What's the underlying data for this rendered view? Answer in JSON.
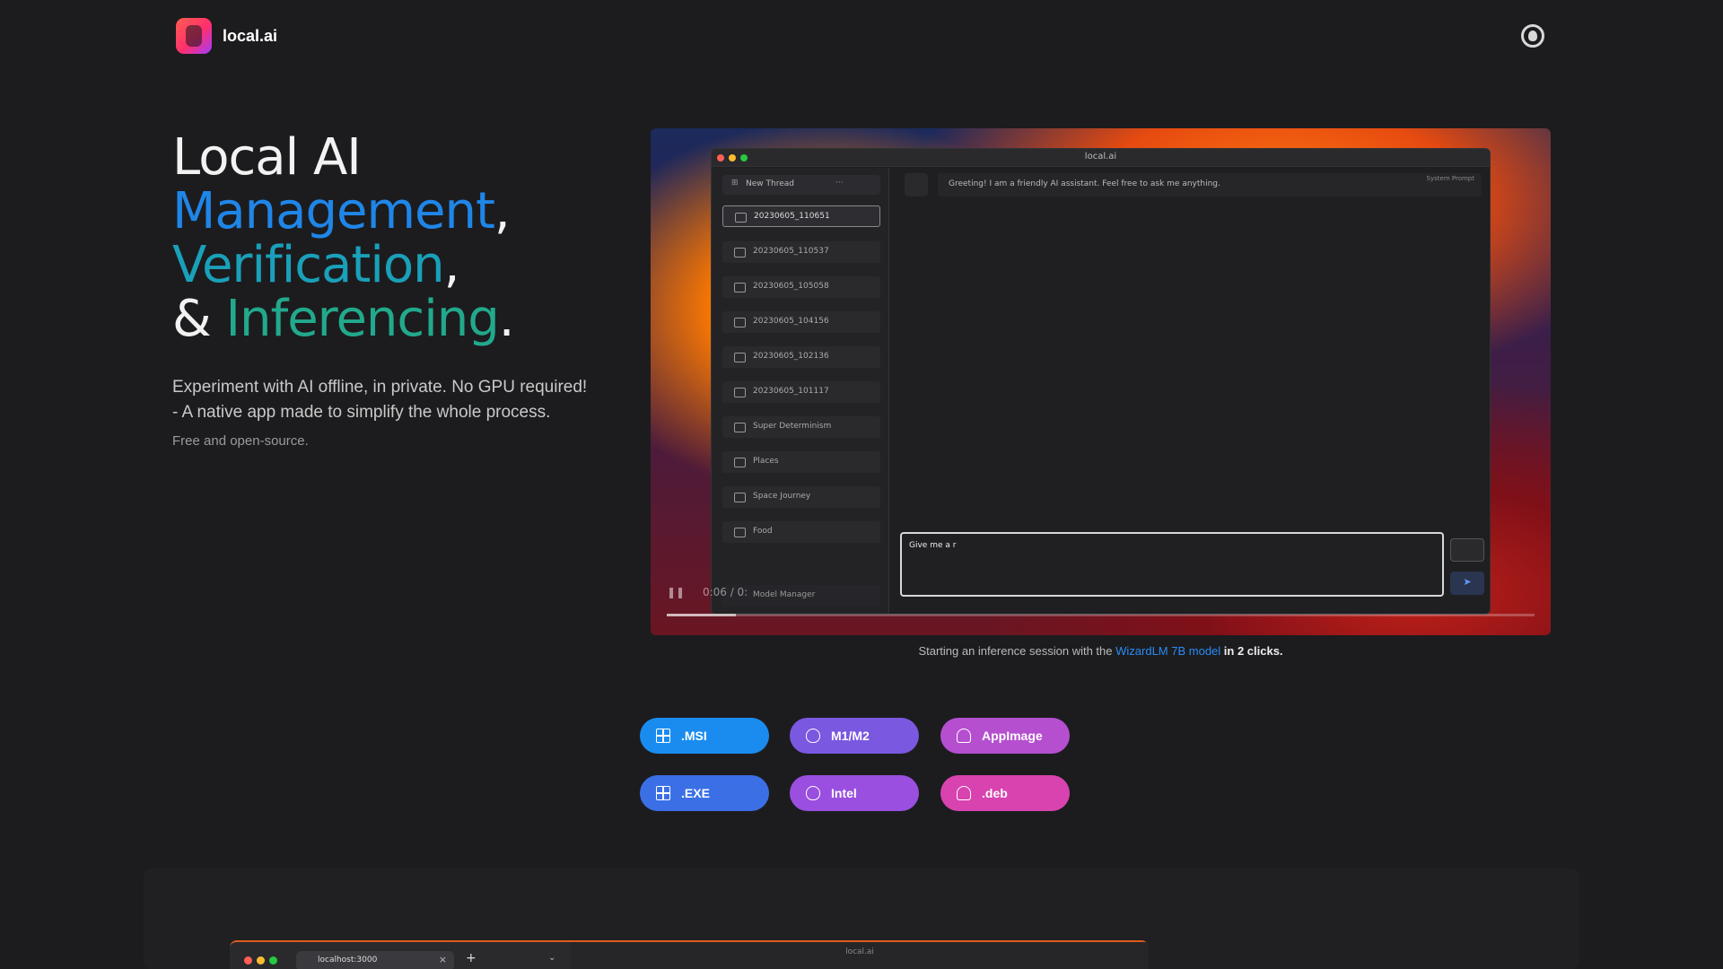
{
  "header": {
    "brand": "local.ai",
    "github_icon": "github-icon"
  },
  "hero": {
    "line1": "Local AI",
    "word_management": "Management",
    "word_verification": "Verification",
    "amp": "&",
    "word_inferencing": "Inferencing",
    "comma": ",",
    "period": ".",
    "sub1": "Experiment with AI offline, in private. No GPU required!",
    "sub2": "- A native app made to simplify the whole process.",
    "free": "Free and open-source."
  },
  "video": {
    "window_title": "local.ai",
    "new_thread": "New Thread",
    "new_thread_more": "···",
    "threads": [
      "20230605_110651",
      "20230605_110537",
      "20230605_105058",
      "20230605_104156",
      "20230605_102136",
      "20230605_101117",
      "Super Determinism",
      "Places",
      "Space Journey",
      "Food"
    ],
    "model_manager": "Model Manager",
    "greeting": "Greeting! I am a friendly AI assistant. Feel free to ask me anything.",
    "system_prompt": "System Prompt",
    "input_text": "Give me a r",
    "send_icon": "➤",
    "time": "0:06 / 0:",
    "progress": 0.08
  },
  "caption": {
    "pre": "Starting an inference session with the ",
    "link": "WizardLM 7B model",
    "post": " in 2 clicks."
  },
  "downloads": [
    {
      "label": ".MSI",
      "icon": "windows-icon",
      "color": "#1a8cf0"
    },
    {
      "label": "M1/M2",
      "icon": "apple-icon",
      "color": "#7a58e0"
    },
    {
      "label": "AppImage",
      "icon": "linux-icon",
      "color": "#b54fd0"
    },
    {
      "label": ".EXE",
      "icon": "windows-icon",
      "color": "#3b6fe6"
    },
    {
      "label": "Intel",
      "icon": "apple-icon",
      "color": "#9a4fe0"
    },
    {
      "label": ".deb",
      "icon": "linux-icon",
      "color": "#d843b0"
    }
  ],
  "lower": {
    "tab_url": "localhost:3000",
    "tab_plus": "+",
    "chevron": "⌄",
    "inner_title": "local.ai"
  }
}
